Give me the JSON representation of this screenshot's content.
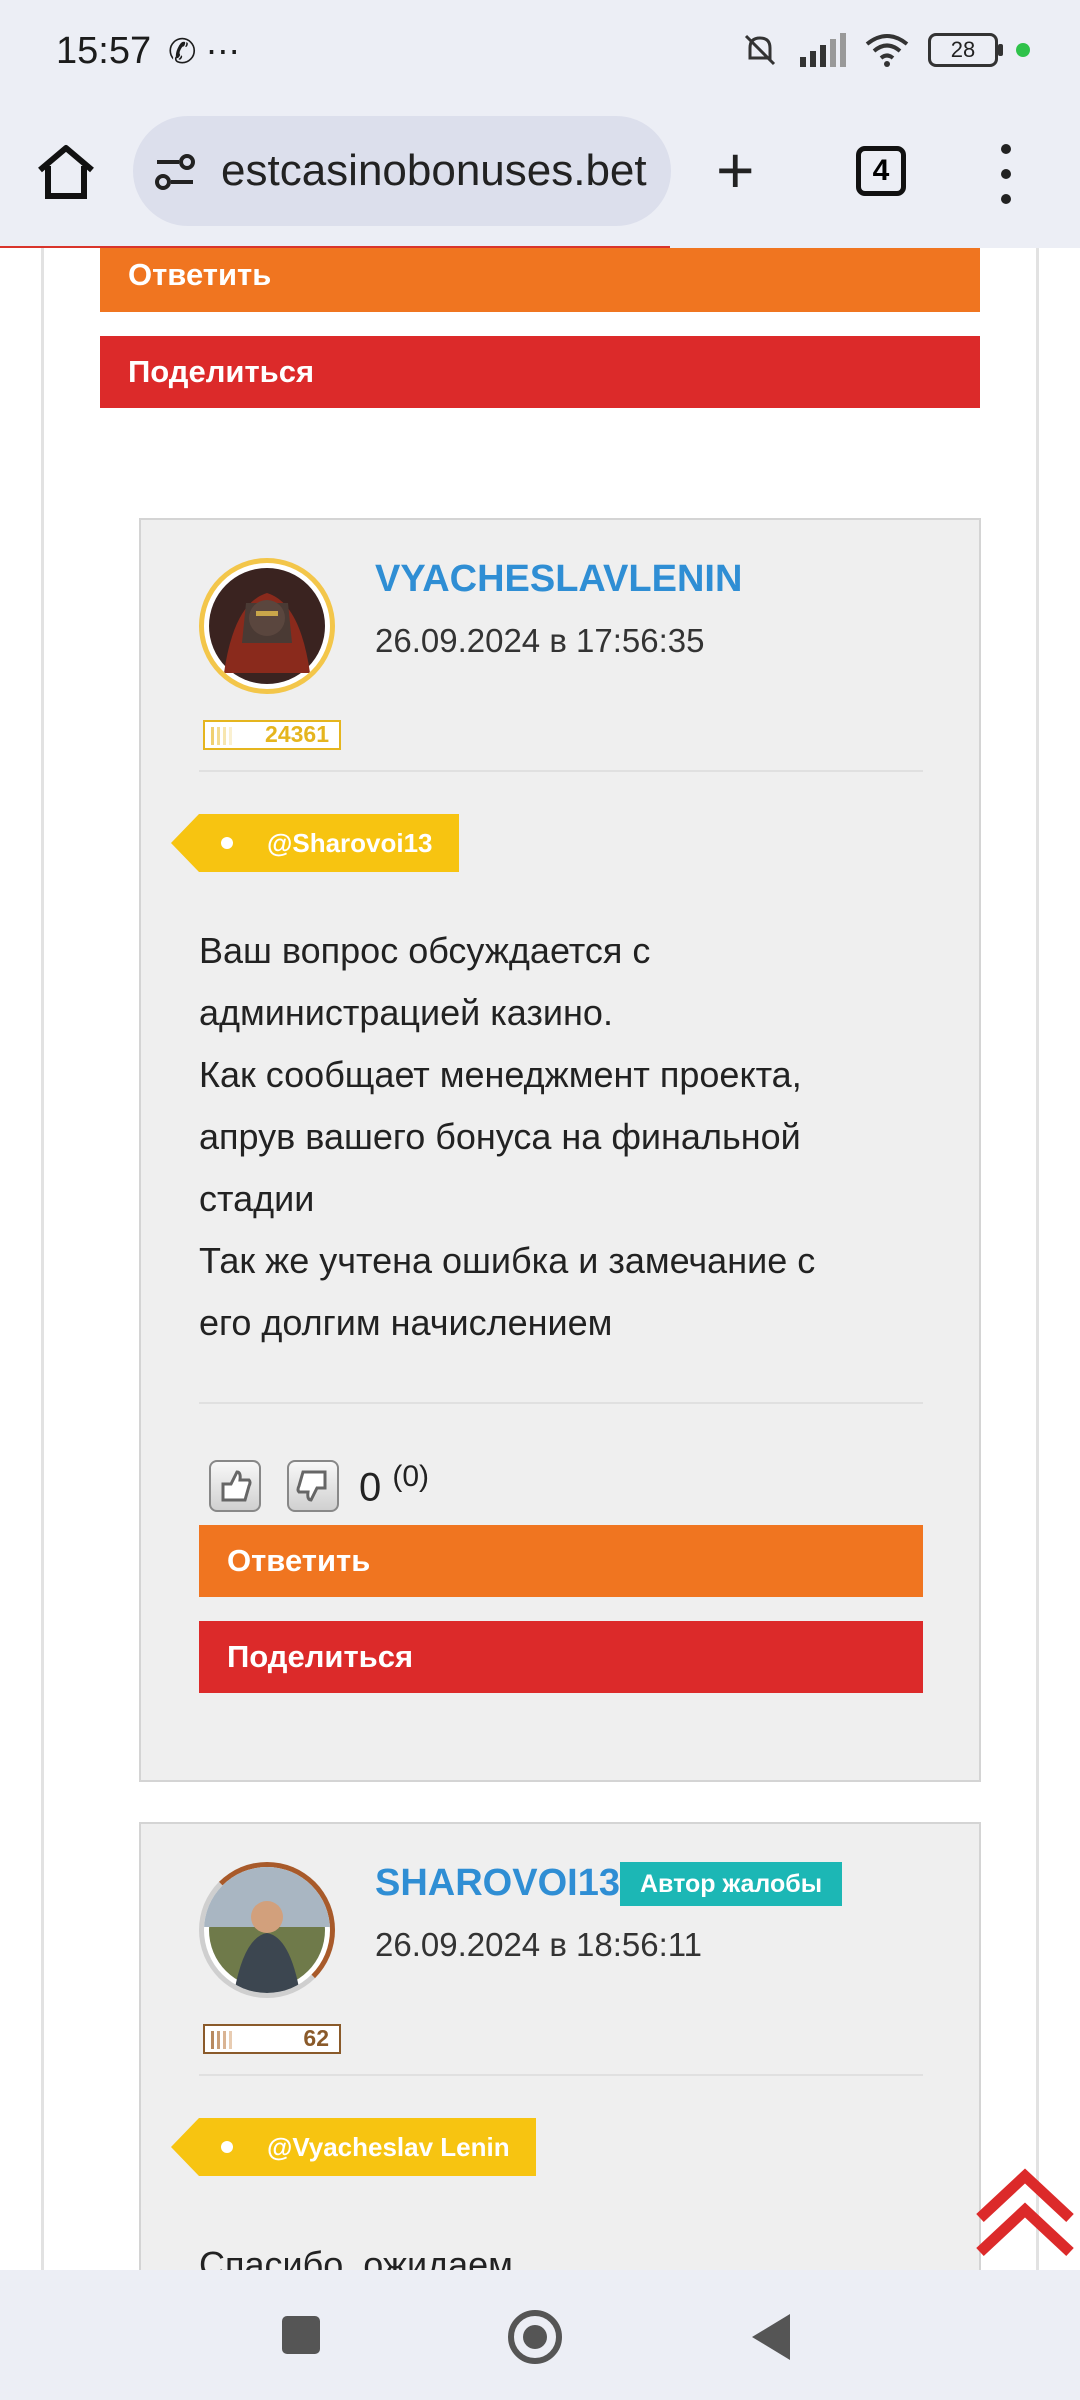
{
  "status": {
    "time": "15:57",
    "left_icons": "✆ ⋯",
    "battery": "28"
  },
  "browser": {
    "url": "estcasinobonuses.bet",
    "tab_count": "4"
  },
  "top_buttons": {
    "reply": "Ответить",
    "share": "Поделиться"
  },
  "comments": [
    {
      "username": "VYACHESLAVLENIN",
      "date": "26.09.2024 в 17:56:35",
      "rank": "24361",
      "rank_color": "#e5b51e",
      "mention": "@Sharovoi13",
      "lines": [
        "Ваш вопрос обсуждается с",
        "администрацией казино.",
        "Как сообщает менеджмент проекта,",
        "апрув вашего бонуса на финальной",
        "стадии",
        "Так же учтена ошибка и замечание с",
        "его долгим начислением"
      ],
      "score": "0",
      "score_count": "(0)",
      "reply": "Ответить",
      "share": "Поделиться"
    },
    {
      "username": "SHAROVOI13",
      "author_badge": "Автор жалобы",
      "date": "26.09.2024 в 18:56:11",
      "rank": "62",
      "rank_color": "#8a5a2a",
      "mention": "@Vyacheslav Lenin",
      "lines": [
        "Спасибо, ожидаем"
      ]
    }
  ],
  "colors": {
    "accent_blue": "#2f8ed4",
    "orange": "#f07520",
    "red": "#dc2a2a",
    "tag_yellow": "#f7c411",
    "teal": "#1cb7b5"
  }
}
